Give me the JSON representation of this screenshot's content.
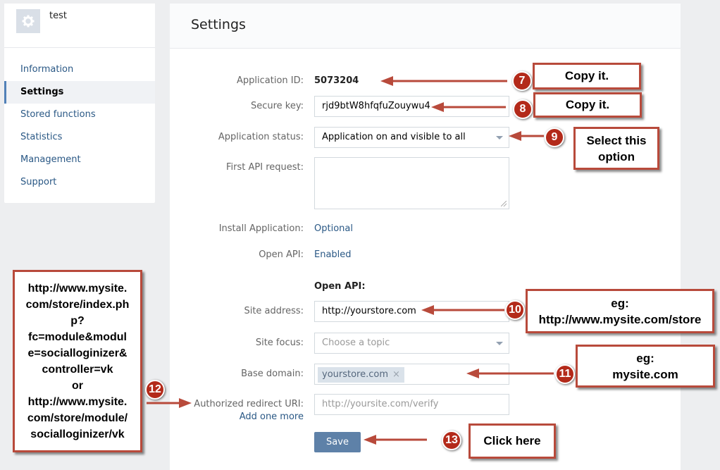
{
  "app": {
    "name": "test",
    "icon": "gear-icon"
  },
  "sidebar": {
    "items": [
      {
        "label": "Information"
      },
      {
        "label": "Settings",
        "active": true
      },
      {
        "label": "Stored functions"
      },
      {
        "label": "Statistics"
      },
      {
        "label": "Management"
      },
      {
        "label": "Support"
      }
    ]
  },
  "settings": {
    "title": "Settings",
    "application_id": {
      "label": "Application ID:",
      "value": "5073204"
    },
    "secure_key": {
      "label": "Secure key:",
      "value": "rjd9btW8hfqfuZouywu4"
    },
    "application_status": {
      "label": "Application status:",
      "value": "Application on and visible to all"
    },
    "first_api_request": {
      "label": "First API request:",
      "value": ""
    },
    "install_application": {
      "label": "Install Application:",
      "value": "Optional"
    },
    "open_api": {
      "label": "Open API:",
      "value": "Enabled"
    },
    "open_api_heading": "Open API:",
    "site_address": {
      "label": "Site address:",
      "value": "http://yourstore.com"
    },
    "site_focus": {
      "label": "Site focus:",
      "placeholder": "Choose a topic"
    },
    "base_domain": {
      "label": "Base domain:",
      "tag": "yourstore.com",
      "remove": "×"
    },
    "redirect_uri": {
      "label": "Authorized redirect URI:",
      "placeholder": "http://yoursite.com/verify",
      "add_more": "Add one more"
    },
    "save_label": "Save"
  },
  "annotations": {
    "n7": {
      "badge": "7",
      "text": "Copy it."
    },
    "n8": {
      "badge": "8",
      "text": "Copy it."
    },
    "n9": {
      "badge": "9",
      "line1": "Select this",
      "line2": "option"
    },
    "n10": {
      "badge": "10",
      "line1": "eg:",
      "line2": "http://www.mysite.com/store"
    },
    "n11": {
      "badge": "11",
      "line1": "eg:",
      "line2": "mysite.com"
    },
    "n12": {
      "badge": "12",
      "lines": [
        "http://www.mysite.",
        "com/store/index.ph",
        "p?",
        "fc=module&modul",
        "e=socialloginizer&",
        "controller=vk",
        "or",
        "http://www.mysite.",
        "com/store/module/",
        "socialloginizer/vk"
      ]
    },
    "n13": {
      "badge": "13",
      "text": "Click here"
    }
  },
  "colors": {
    "accent": "#2a5885",
    "annotation": "#b84a3b",
    "badge": "#b32a1a",
    "button": "#5e81a8"
  }
}
